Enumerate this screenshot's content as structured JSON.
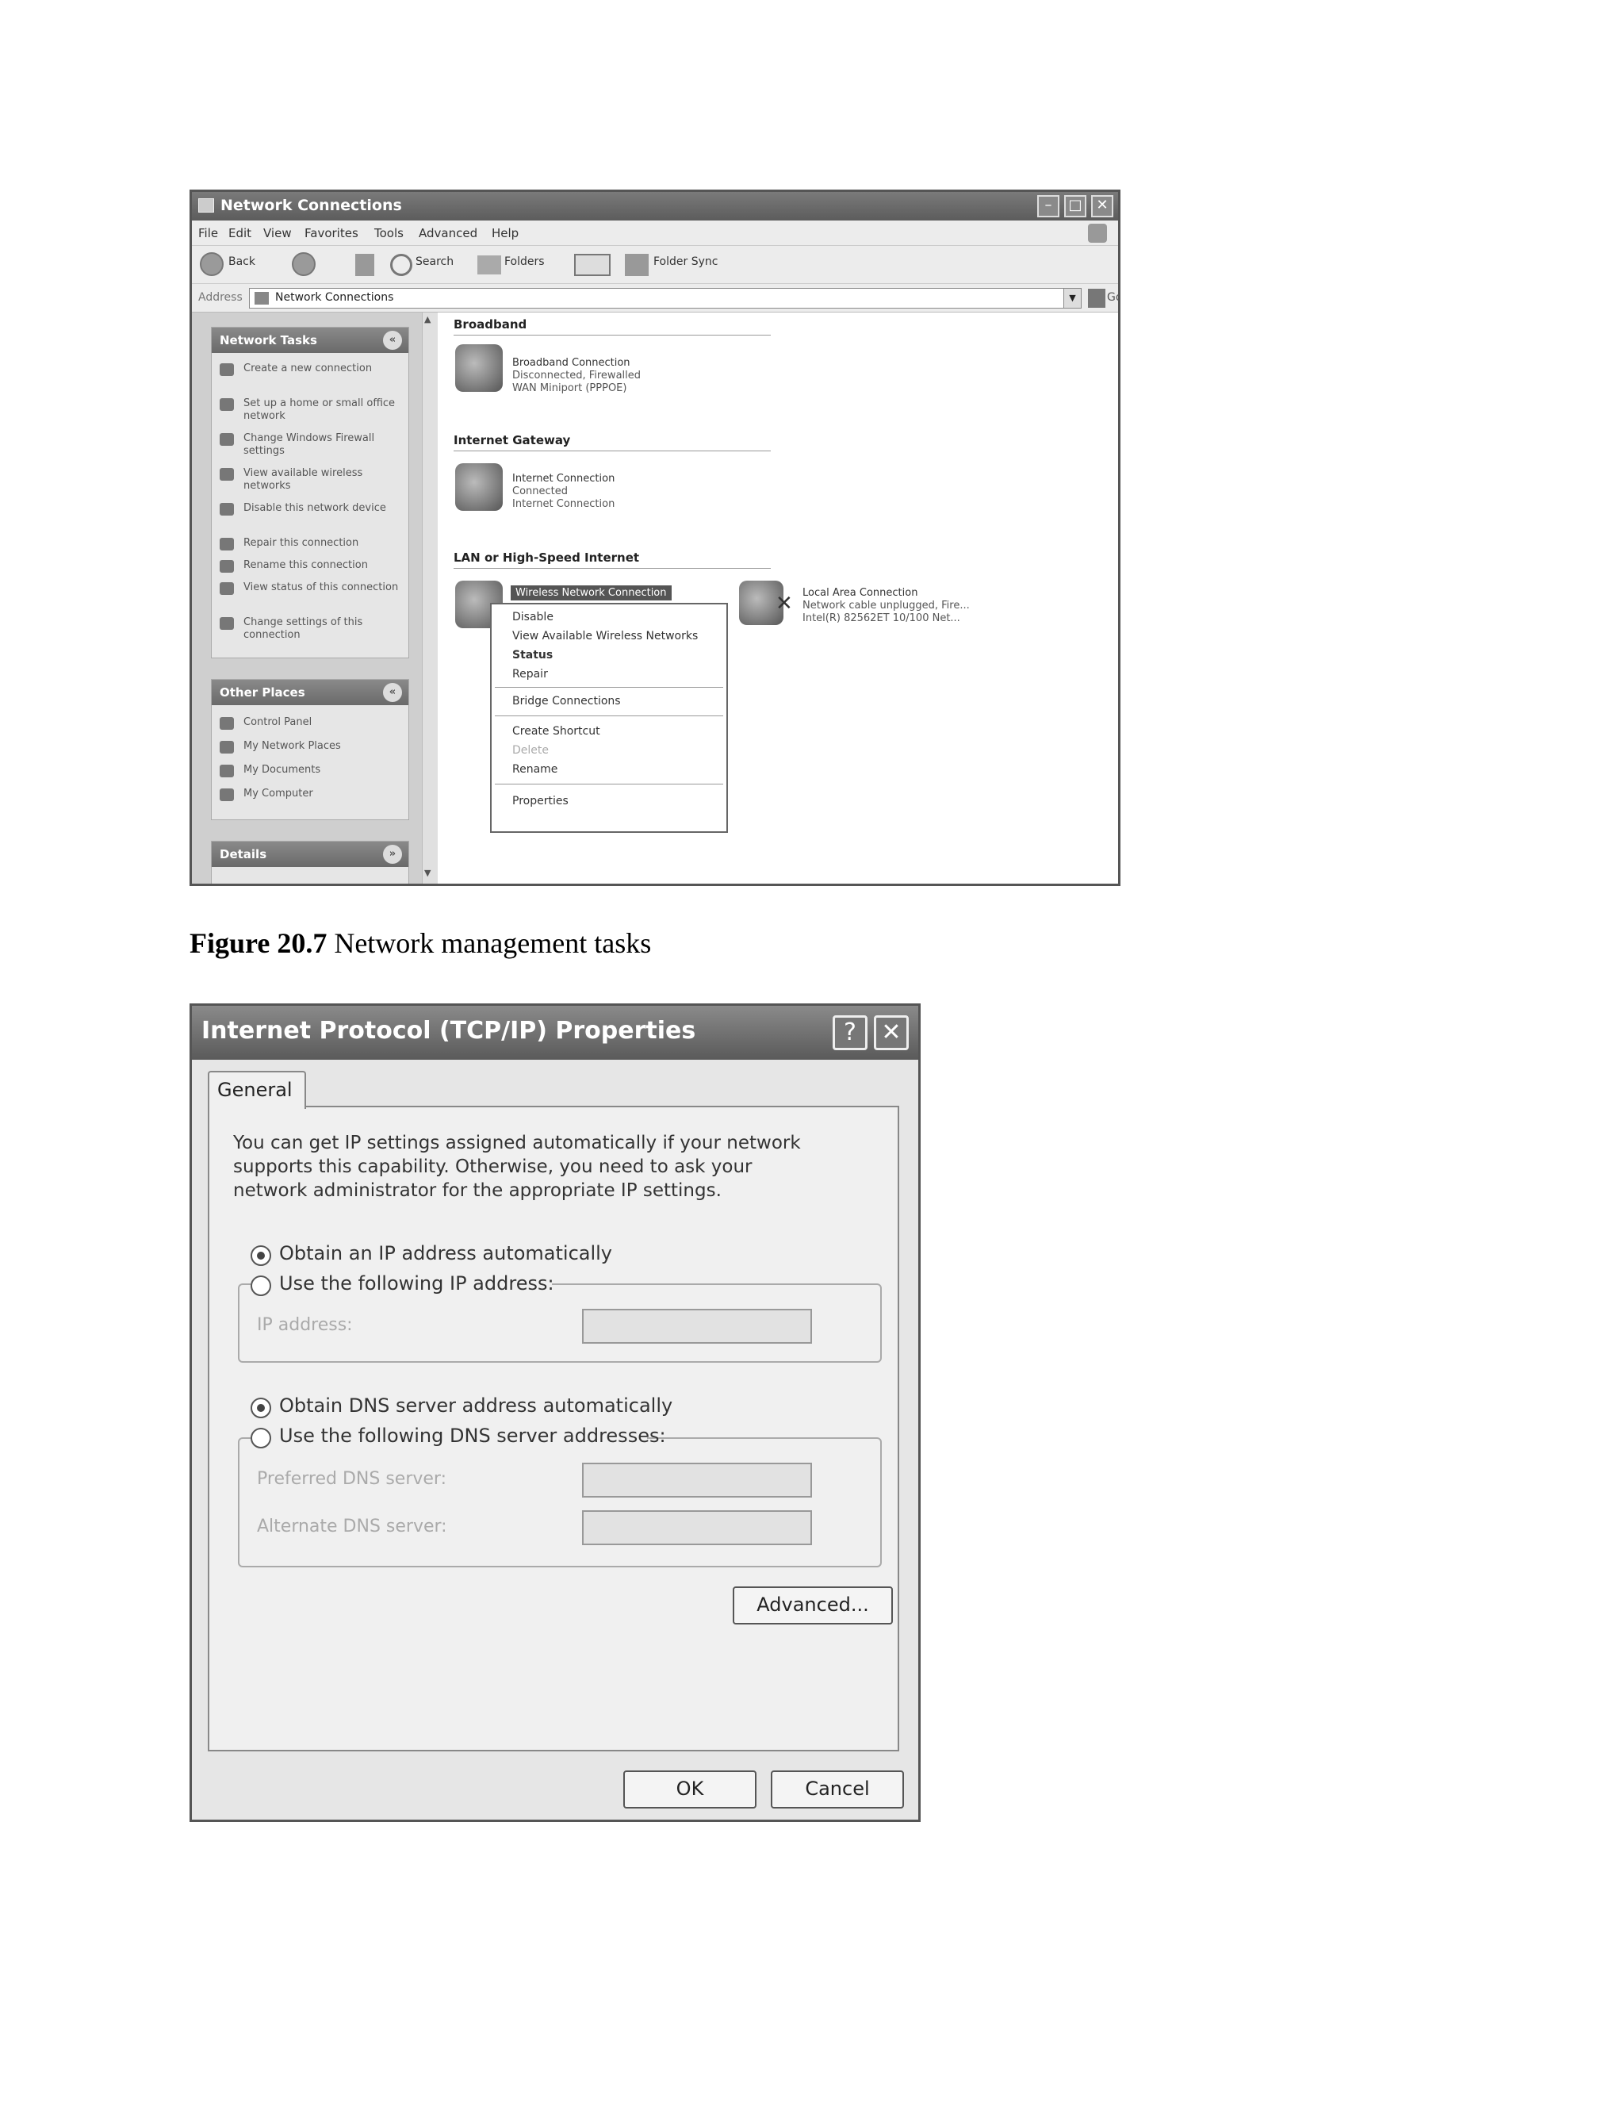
{
  "nc_window": {
    "title": "Network Connections",
    "menu": [
      "File",
      "Edit",
      "View",
      "Favorites",
      "Tools",
      "Advanced",
      "Help"
    ],
    "toolbar": {
      "back": "Back",
      "search": "Search",
      "folders": "Folders",
      "folder_sync": "Folder Sync"
    },
    "address": {
      "label": "Address",
      "value": "Network Connections",
      "go": "Go"
    },
    "network_tasks": {
      "title": "Network Tasks",
      "items": [
        "Create a new connection",
        "Set up a home or small office network",
        "Change Windows Firewall settings",
        "View available wireless networks",
        "Disable this network device",
        "Repair this connection",
        "Rename this connection",
        "View status of this connection",
        "Change settings of this connection"
      ]
    },
    "other_places": {
      "title": "Other Places",
      "items": [
        "Control Panel",
        "My Network Places",
        "My Documents",
        "My Computer"
      ]
    },
    "details": {
      "title": "Details"
    },
    "sections": {
      "broadband": {
        "title": "Broadband",
        "name": "Broadband Connection",
        "status": "Disconnected, Firewalled",
        "device": "WAN Miniport (PPPOE)"
      },
      "gateway": {
        "title": "Internet Gateway",
        "name": "Internet Connection",
        "status": "Connected",
        "device": "Internet Connection"
      },
      "lan": {
        "title": "LAN or High-Speed Internet",
        "wireless_name": "Wireless Network Connection",
        "local_name": "Local Area Connection",
        "local_status": "Network cable unplugged, Fire...",
        "local_device": "Intel(R) 82562ET 10/100 Net..."
      }
    },
    "context_menu": {
      "items": [
        "Disable",
        "View Available Wireless Networks",
        "Status",
        "Repair",
        "Bridge Connections",
        "Create Shortcut",
        "Delete",
        "Rename",
        "Properties"
      ]
    }
  },
  "caption": {
    "label": "Figure 20.7",
    "text": " Network management tasks"
  },
  "tcp_dialog": {
    "title": "Internet Protocol (TCP/IP) Properties",
    "help": "?",
    "close": "✕",
    "tab": "General",
    "description": "You can get IP settings assigned automatically if your network supports this capability. Otherwise, you need to ask your network administrator for the appropriate IP settings.",
    "ip_auto": "Obtain an IP address automatically",
    "ip_manual": "Use the following IP address:",
    "ip_address_label": "IP address:",
    "dns_auto": "Obtain DNS server address automatically",
    "dns_manual": "Use the following DNS server addresses:",
    "preferred_dns_label": "Preferred DNS server:",
    "alternate_dns_label": "Alternate DNS server:",
    "advanced": "Advanced...",
    "ok": "OK",
    "cancel": "Cancel"
  }
}
